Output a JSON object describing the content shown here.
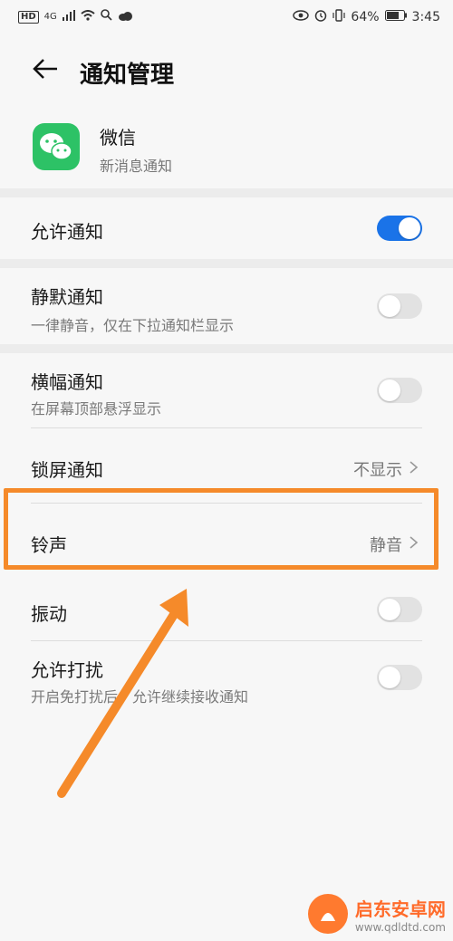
{
  "statusbar": {
    "hd": "HD",
    "network": "4G",
    "battery": "64%",
    "time": "3:45"
  },
  "header": {
    "title": "通知管理"
  },
  "app": {
    "name": "微信",
    "subtitle": "新消息通知"
  },
  "settings": {
    "allow": {
      "label": "允许通知",
      "state": "on"
    },
    "silent": {
      "label": "静默通知",
      "sub": "一律静音，仅在下拉通知栏显示",
      "state": "off"
    },
    "banner": {
      "label": "横幅通知",
      "sub": "在屏幕顶部悬浮显示",
      "state": "off"
    },
    "lock": {
      "label": "锁屏通知",
      "value": "不显示"
    },
    "ringtone": {
      "label": "铃声",
      "value": "静音"
    },
    "vibrate": {
      "label": "振动",
      "state": "off"
    },
    "dnd": {
      "label": "允许打扰",
      "sub": "开启免打扰后，允许继续接收通知",
      "state": "off"
    }
  },
  "colors": {
    "toggle_on": "#1a73e8",
    "highlight": "#f58a2a",
    "app_icon": "#2dc266"
  },
  "watermark": {
    "name": "启东安卓网",
    "url": "www.qdldtd.com"
  }
}
